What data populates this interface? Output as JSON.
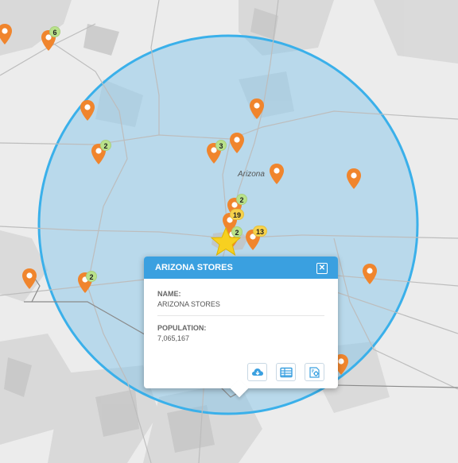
{
  "map": {
    "region_label": "Arizona",
    "colors": {
      "land": "#e9e9e9",
      "mountain": "#d6d6d6",
      "dark_terrain": "#c5c5c5",
      "radius_fill": "#7cc4ea",
      "radius_stroke": "#3ab0ea",
      "pin": "#f0852d",
      "badge_green": "#b9e28a",
      "badge_yellow": "#f7d24a",
      "star": "#f7d020"
    }
  },
  "cluster_badges": {
    "b1": "6",
    "b2": "2",
    "b3": "3",
    "b4": "2",
    "b5": "19",
    "b6": "2",
    "b7": "13",
    "b8": "2"
  },
  "popup": {
    "title": "ARIZONA STORES",
    "name_label": "NAME:",
    "name_value": "ARIZONA STORES",
    "population_label": "POPULATION:",
    "population_value": "7,065,167",
    "actions": [
      "download-icon",
      "table-icon",
      "settings-icon"
    ]
  }
}
